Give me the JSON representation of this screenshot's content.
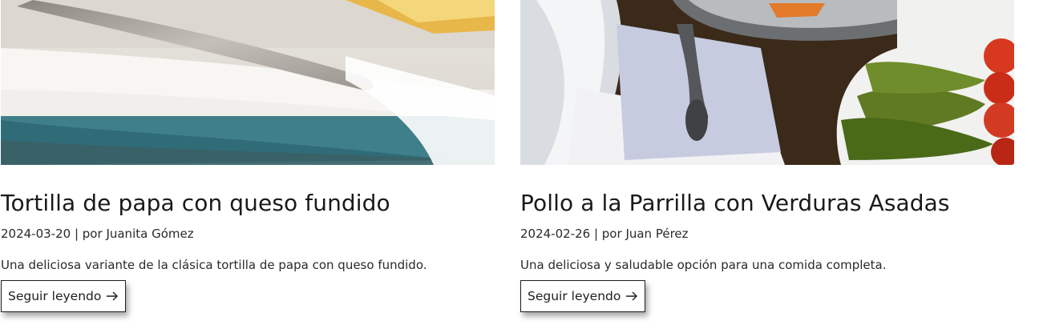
{
  "posts": [
    {
      "title": "Tortilla de papa con queso fundido",
      "date": "2024-03-20",
      "separator": "| por",
      "author": "Juanita Gómez",
      "excerpt": "Una deliciosa variante de la clásica tortilla de papa con queso fundido.",
      "read_more": "Seguir leyendo",
      "image_icon": "food-photo-tortilla"
    },
    {
      "title": "Pollo a la Parrilla con Verduras Asadas",
      "date": "2024-02-26",
      "separator": "| por",
      "author": "Juan Pérez",
      "excerpt": "Una deliciosa y saludable opción para una comida completa.",
      "read_more": "Seguir leyendo",
      "image_icon": "food-photo-grilled-chicken"
    }
  ],
  "colors": {
    "text": "#1e1e1e",
    "background": "#ffffff",
    "button_border": "#1e1e1e"
  }
}
